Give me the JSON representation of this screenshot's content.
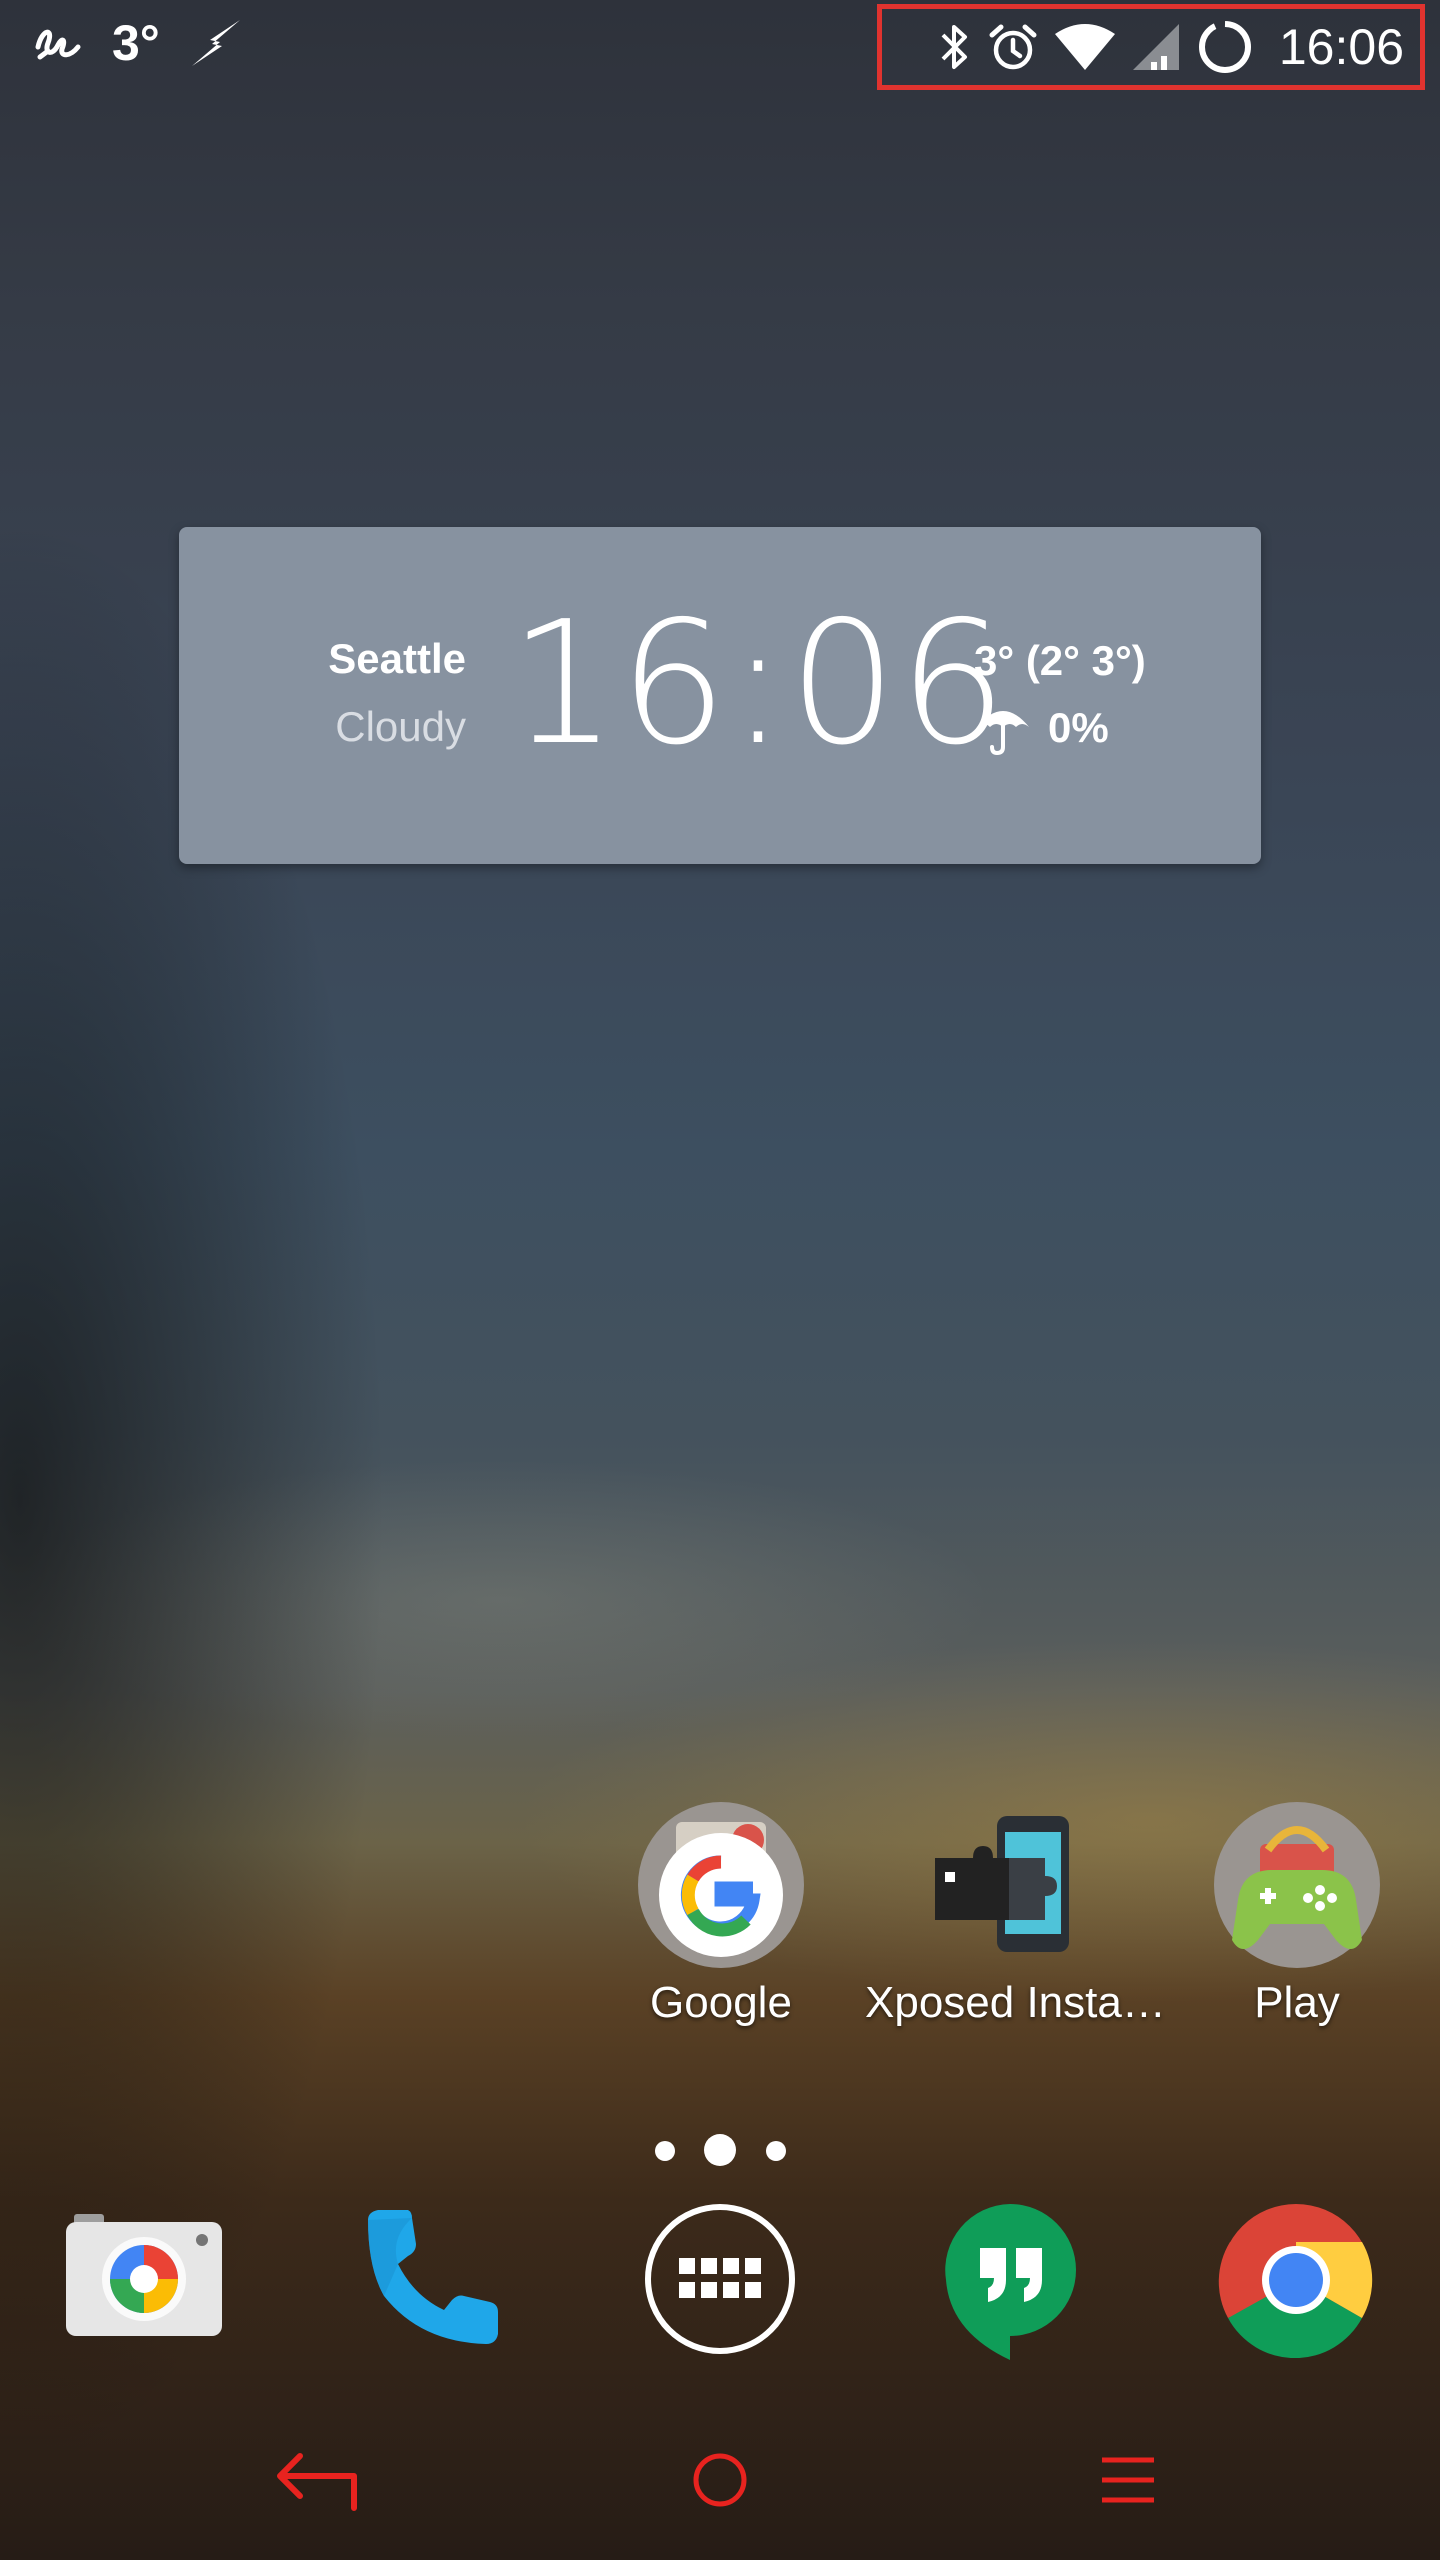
{
  "status_bar": {
    "left": {
      "app_icon": "signature-icon",
      "temperature": "3°",
      "charging_icon": "lightning-icon"
    },
    "right": {
      "icons": [
        "bluetooth-icon",
        "alarm-icon",
        "wifi-icon",
        "cell-signal-icon",
        "battery-ring-icon"
      ],
      "time": "16:06",
      "highlight_color": "#e0332f"
    }
  },
  "weather_widget": {
    "city": "Seattle",
    "condition": "Cloudy",
    "time": "16:06",
    "temps": "3° (2° 3°)",
    "rain_icon": "umbrella-icon",
    "rain_chance": "0%"
  },
  "home_apps": [
    {
      "label": "Google",
      "icon": "google-folder-icon"
    },
    {
      "label": "Xposed Insta…",
      "icon": "xposed-installer-icon"
    },
    {
      "label": "Play",
      "icon": "play-games-folder-icon"
    }
  ],
  "page_indicator": {
    "pages": 3,
    "current": 2
  },
  "dock": [
    {
      "name": "camera",
      "icon": "camera-icon"
    },
    {
      "name": "phone",
      "icon": "phone-icon"
    },
    {
      "name": "app-drawer",
      "icon": "app-drawer-icon"
    },
    {
      "name": "hangouts",
      "icon": "hangouts-icon"
    },
    {
      "name": "chrome",
      "icon": "chrome-icon"
    }
  ],
  "nav_bar": {
    "color": "#e8231f",
    "buttons": [
      "back-icon",
      "home-icon",
      "menu-icon"
    ]
  }
}
